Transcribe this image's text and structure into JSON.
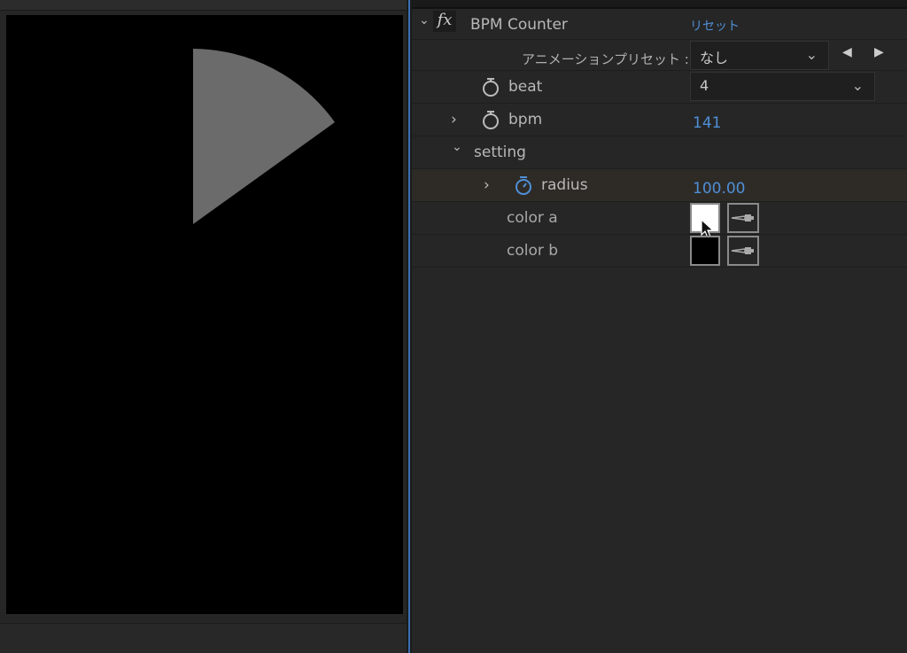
{
  "effect": {
    "name": "BPM Counter",
    "reset_label": "リセット",
    "fx_label": "fx"
  },
  "preset": {
    "label": "アニメーションプリセット :",
    "value": "なし"
  },
  "properties": {
    "beat": {
      "label": "beat",
      "value": "4"
    },
    "bpm": {
      "label": "bpm",
      "value": "141"
    },
    "setting": {
      "label": "setting"
    },
    "radius": {
      "label": "radius",
      "value": "100.00"
    },
    "color_a": {
      "label": "color a",
      "color": "#ffffff"
    },
    "color_b": {
      "label": "color b",
      "color": "#000000"
    }
  },
  "colors": {
    "accent": "#4f8fd6",
    "wedge": "#6b6b6b"
  }
}
